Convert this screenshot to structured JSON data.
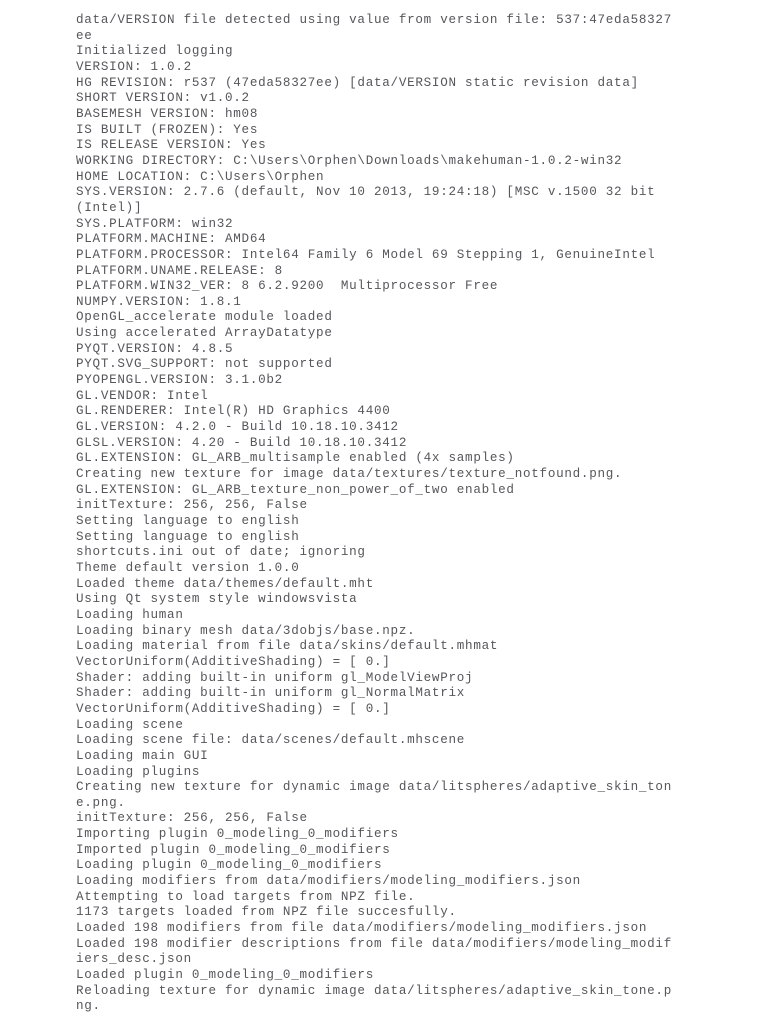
{
  "document": {
    "kind": "plain-text-log",
    "background_color": "#ffffff",
    "text_color": "#56565b",
    "application": "MakeHuman 1.0.2 startup log"
  },
  "log": {
    "lines": [
      "data/VERSION file detected using value from version file: 537:47eda58327ee",
      "Initialized logging",
      "VERSION: 1.0.2",
      "HG REVISION: r537 (47eda58327ee) [data/VERSION static revision data]",
      "SHORT VERSION: v1.0.2",
      "BASEMESH VERSION: hm08",
      "IS BUILT (FROZEN): Yes",
      "IS RELEASE VERSION: Yes",
      "WORKING DIRECTORY: C:\\Users\\Orphen\\Downloads\\makehuman-1.0.2-win32",
      "HOME LOCATION: C:\\Users\\Orphen",
      "SYS.VERSION: 2.7.6 (default, Nov 10 2013, 19:24:18) [MSC v.1500 32 bit (Intel)]",
      "SYS.PLATFORM: win32",
      "PLATFORM.MACHINE: AMD64",
      "PLATFORM.PROCESSOR: Intel64 Family 6 Model 69 Stepping 1, GenuineIntel",
      "PLATFORM.UNAME.RELEASE: 8",
      "PLATFORM.WIN32_VER: 8 6.2.9200  Multiprocessor Free",
      "NUMPY.VERSION: 1.8.1",
      "OpenGL_accelerate module loaded",
      "Using accelerated ArrayDatatype",
      "PYQT.VERSION: 4.8.5",
      "PYQT.SVG_SUPPORT: not supported",
      "PYOPENGL.VERSION: 3.1.0b2",
      "GL.VENDOR: Intel",
      "GL.RENDERER: Intel(R) HD Graphics 4400",
      "GL.VERSION: 4.2.0 - Build 10.18.10.3412",
      "GLSL.VERSION: 4.20 - Build 10.18.10.3412",
      "GL.EXTENSION: GL_ARB_multisample enabled (4x samples)",
      "Creating new texture for image data/textures/texture_notfound.png.",
      "GL.EXTENSION: GL_ARB_texture_non_power_of_two enabled",
      "initTexture: 256, 256, False",
      "Setting language to english",
      "Setting language to english",
      "shortcuts.ini out of date; ignoring",
      "Theme default version 1.0.0",
      "Loaded theme data/themes/default.mht",
      "Using Qt system style windowsvista",
      "Loading human",
      "Loading binary mesh data/3dobjs/base.npz.",
      "Loading material from file data/skins/default.mhmat",
      "VectorUniform(AdditiveShading) = [ 0.]",
      "Shader: adding built-in uniform gl_ModelViewProj",
      "Shader: adding built-in uniform gl_NormalMatrix",
      "VectorUniform(AdditiveShading) = [ 0.]",
      "Loading scene",
      "Loading scene file: data/scenes/default.mhscene",
      "Loading main GUI",
      "Loading plugins",
      "Creating new texture for dynamic image data/litspheres/adaptive_skin_tone.png.",
      "initTexture: 256, 256, False",
      "Importing plugin 0_modeling_0_modifiers",
      "Imported plugin 0_modeling_0_modifiers",
      "Loading plugin 0_modeling_0_modifiers",
      "Loading modifiers from data/modifiers/modeling_modifiers.json",
      "Attempting to load targets from NPZ file.",
      "1173 targets loaded from NPZ file succesfully.",
      "Loaded 198 modifiers from file data/modifiers/modeling_modifiers.json",
      "Loaded 198 modifier descriptions from file data/modifiers/modeling_modifiers_desc.json",
      "Loaded plugin 0_modeling_0_modifiers",
      "Reloading texture for dynamic image data/litspheres/adaptive_skin_tone.png."
    ]
  }
}
